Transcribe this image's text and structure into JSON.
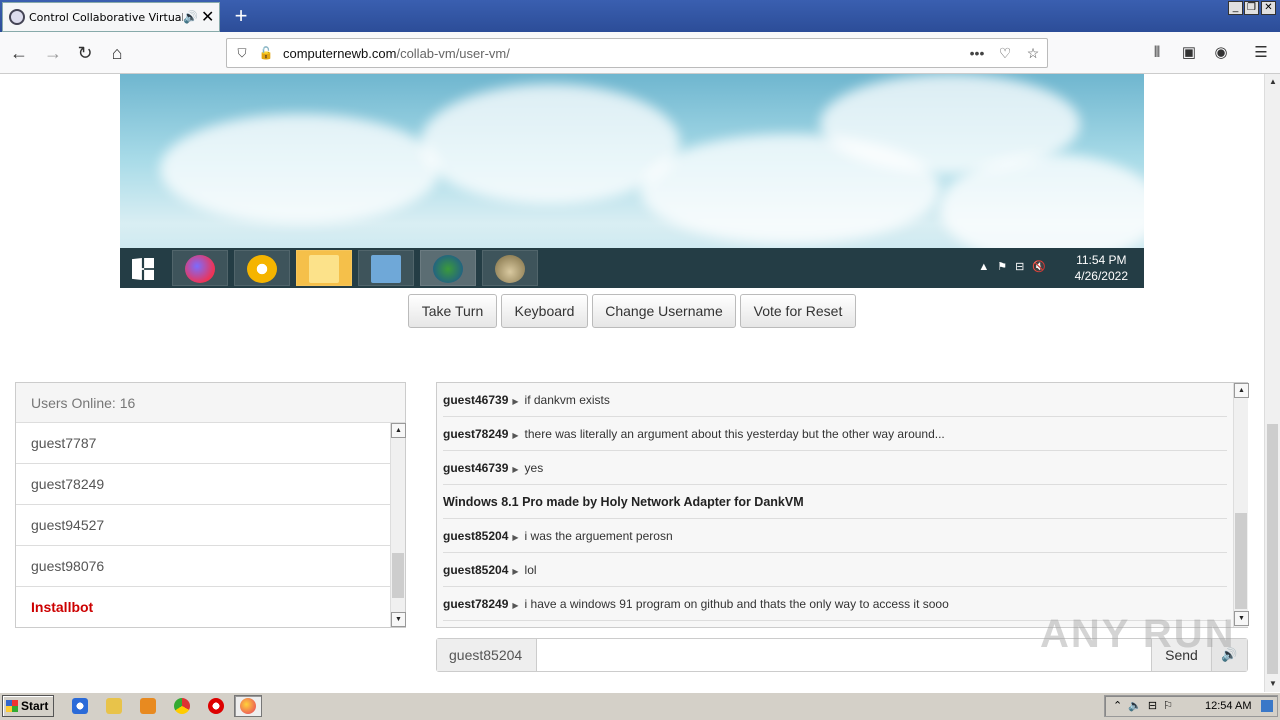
{
  "browser": {
    "tab_title": "Control Collaborative Virtual M",
    "new_tab_icon": "+",
    "url_domain": "computernewb.com",
    "url_path": "/collab-vm/user-vm/",
    "page_actions_icon": "•••",
    "window_controls": [
      "_",
      "❐",
      "✕"
    ]
  },
  "vm": {
    "clock_time": "11:54 PM",
    "clock_date": "4/26/2022",
    "taskbar_apps": [
      "firefox",
      "chrome",
      "file-explorer",
      "explorer-window",
      "installer",
      "tor-browser"
    ]
  },
  "controls": {
    "take_turn": "Take Turn",
    "keyboard": "Keyboard",
    "change_username": "Change Username",
    "vote_reset": "Vote for Reset"
  },
  "users": {
    "header": "Users Online: 16",
    "list": [
      {
        "name": "guest7787",
        "type": "user"
      },
      {
        "name": "guest78249",
        "type": "user"
      },
      {
        "name": "guest94527",
        "type": "user"
      },
      {
        "name": "guest98076",
        "type": "user"
      },
      {
        "name": "Installbot",
        "type": "bot"
      }
    ]
  },
  "chat": {
    "messages": [
      {
        "user": "guest46739",
        "text": "if dankvm exists"
      },
      {
        "user": "guest78249",
        "text": "there was literally an argument about this yesterday but the other way around..."
      },
      {
        "user": "guest46739",
        "text": "yes"
      },
      {
        "user": "",
        "text": "Windows 8.1 Pro made by Holy Network Adapter for DankVM"
      },
      {
        "user": "guest85204",
        "text": "i was the arguement perosn"
      },
      {
        "user": "guest85204",
        "text": "lol"
      },
      {
        "user": "guest78249",
        "text": "i have a windows 91 program on github and thats the only way to access it sooo"
      }
    ],
    "username": "guest85204",
    "input_value": "",
    "send_label": "Send",
    "arrow": "▶"
  },
  "watermark": "ANY RUN",
  "host": {
    "start_label": "Start",
    "tray_time": "12:54 AM"
  }
}
